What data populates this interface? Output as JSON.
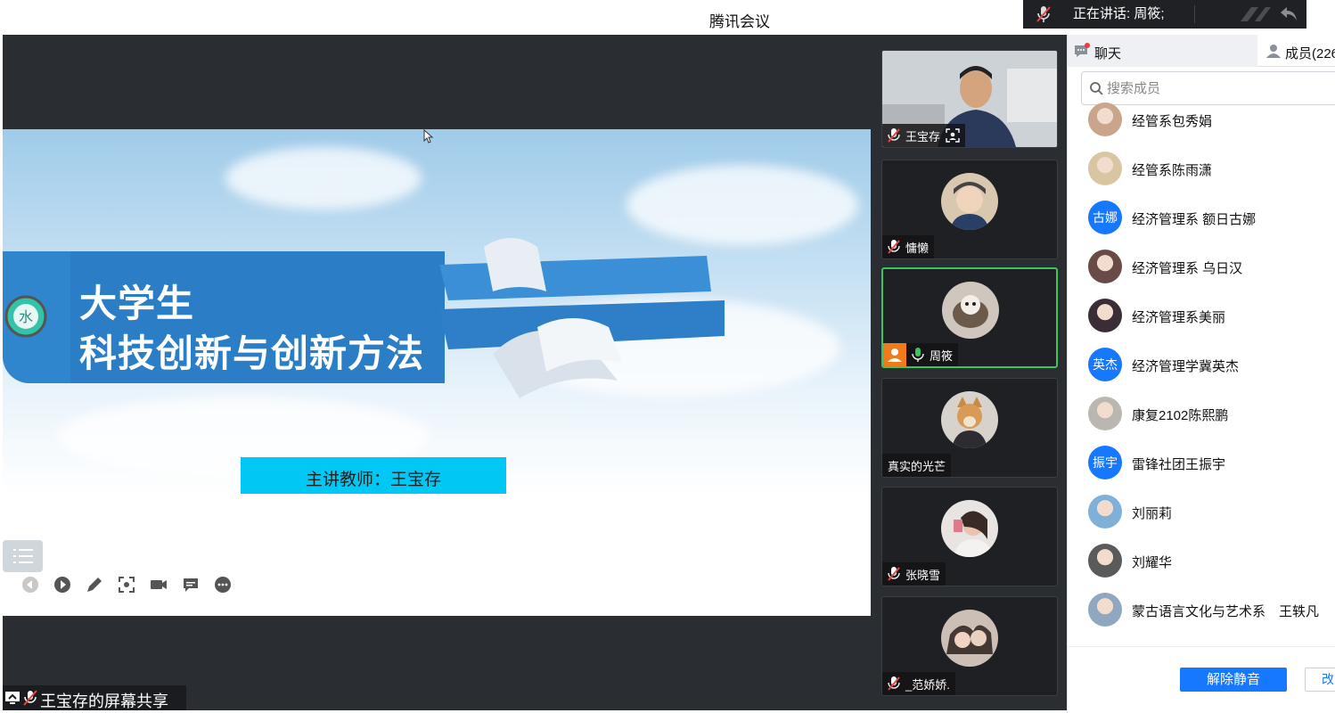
{
  "window": {
    "title": "腾讯会议"
  },
  "speaking": {
    "label": "正在讲话: 周筱;"
  },
  "slide": {
    "title_line1": "大学生",
    "title_line2": "科技创新与创新方法",
    "lecturer": "主讲教师：王宝存"
  },
  "share": {
    "label": "王宝存的屏幕共享"
  },
  "videos": [
    {
      "name": "王宝存",
      "muted": true
    },
    {
      "name": "慵懒",
      "muted": true
    },
    {
      "name": "周筱",
      "muted": false,
      "active": true
    },
    {
      "name": "真实的光芒"
    },
    {
      "name": "张晓雪",
      "muted": true
    },
    {
      "name": "_范娇娇.",
      "muted": true
    }
  ],
  "panel": {
    "tab_chat": "聊天",
    "tab_members": "成员(226",
    "search_placeholder": "搜索成员",
    "members": [
      {
        "name": "经管系包秀娟",
        "avatar": "photo",
        "color": "#c9a58c"
      },
      {
        "name": "经管系陈雨潇",
        "avatar": "photo",
        "color": "#d8c6a2"
      },
      {
        "name": "经济管理系 额日古娜",
        "avatar": "古娜"
      },
      {
        "name": "经济管理系 乌日汉",
        "avatar": "photo",
        "color": "#6a4a46"
      },
      {
        "name": "经济管理系美丽",
        "avatar": "photo",
        "color": "#3b2d35"
      },
      {
        "name": "经济管理学冀英杰",
        "avatar": "英杰"
      },
      {
        "name": "康复2102陈熙鹏",
        "avatar": "photo",
        "color": "#b9b7b0"
      },
      {
        "name": "雷锋社团王振宇",
        "avatar": "振宇"
      },
      {
        "name": "刘丽莉",
        "avatar": "photo",
        "color": "#7fb0d8"
      },
      {
        "name": "刘耀华",
        "avatar": "photo",
        "color": "#5a5a5a"
      },
      {
        "name": "蒙古语言文化与艺术系　王轶凡",
        "avatar": "photo",
        "color": "#8fa8c0"
      }
    ],
    "unmute_label": "解除静音",
    "more_label": "改"
  },
  "colors": {
    "accent": "#1677ff",
    "active_border": "#3ec45e",
    "lecturer_box": "#00c8f5",
    "banner": "#2f86cc"
  }
}
